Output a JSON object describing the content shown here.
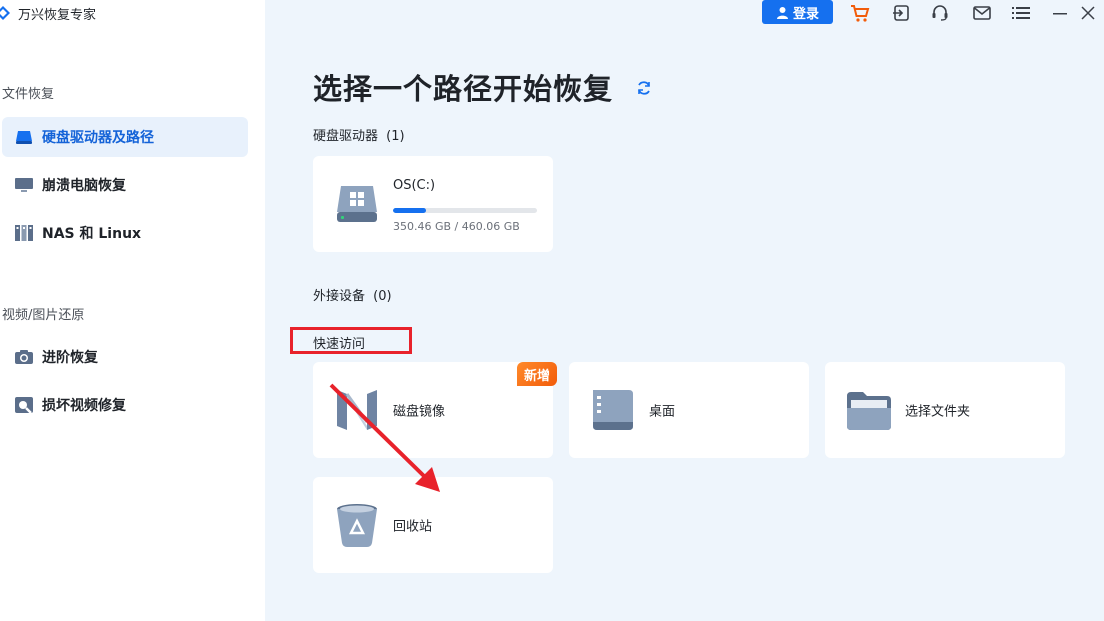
{
  "app": {
    "title": "万兴恢复专家"
  },
  "sidebar": {
    "sections": [
      {
        "title": "文件恢复"
      },
      {
        "title": "视频/图片还原"
      }
    ],
    "items": [
      {
        "label": "硬盘驱动器及路径",
        "icon": "hard-drive-icon"
      },
      {
        "label": "崩溃电脑恢复",
        "icon": "monitor-icon"
      },
      {
        "label": "NAS 和 Linux",
        "icon": "nas-icon"
      },
      {
        "label": "进阶恢复",
        "icon": "camera-icon"
      },
      {
        "label": "损坏视频修复",
        "icon": "video-repair-icon"
      }
    ]
  },
  "header": {
    "login_label": "登录",
    "icons": [
      "cart-icon",
      "sign-in-icon",
      "headset-icon",
      "mail-icon",
      "menu-icon",
      "minimize-icon",
      "close-icon"
    ]
  },
  "main": {
    "title": "选择一个路径开始恢复",
    "drives_title": "硬盘驱动器",
    "drives_count": "(1)",
    "drives": [
      {
        "name": "OS(C:)",
        "size": "350.46 GB / 460.06 GB",
        "used_fraction": 0.23
      }
    ],
    "external_title": "外接设备",
    "external_count": "(0)",
    "quick_access_title": "快速访问",
    "quick_access": [
      {
        "label": "磁盘镜像",
        "icon": "disk-image-icon",
        "badge": "新增"
      },
      {
        "label": "桌面",
        "icon": "desktop-icon"
      },
      {
        "label": "选择文件夹",
        "icon": "folder-icon"
      },
      {
        "label": "回收站",
        "icon": "recycle-bin-icon"
      }
    ]
  },
  "colors": {
    "accent": "#1570ef",
    "badge": "#f25c0a",
    "highlight": "#e8222b"
  }
}
